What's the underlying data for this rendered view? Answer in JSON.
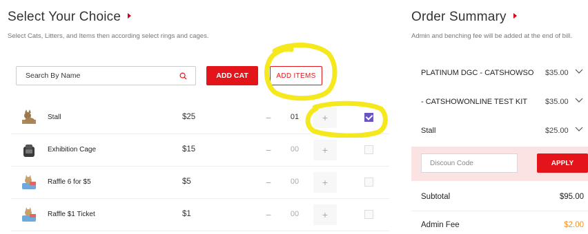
{
  "left_panel": {
    "title": "Select Your Choice",
    "subtitle": "Select Cats, Litters, and Items then according select rings and cages.",
    "search": {
      "placeholder": "Search By Name"
    },
    "add_cat_label": "ADD CAT",
    "add_items_label": "ADD ITEMS",
    "items": [
      {
        "name": "Stall",
        "price": "$25",
        "minus": "−",
        "qty": "01",
        "plus": "+",
        "checked": true,
        "icon": "cat-stall-icon"
      },
      {
        "name": "Exhibition Cage",
        "price": "$15",
        "minus": "−",
        "qty": "00",
        "plus": "+",
        "checked": false,
        "icon": "cage-icon"
      },
      {
        "name": "Raffle 6 for $5",
        "price": "$5",
        "minus": "−",
        "qty": "00",
        "plus": "+",
        "checked": false,
        "icon": "raffle-ticket-icon"
      },
      {
        "name": "Raffle $1 Ticket",
        "price": "$1",
        "minus": "−",
        "qty": "00",
        "plus": "+",
        "checked": false,
        "icon": "raffle-ticket-icon"
      }
    ]
  },
  "right_panel": {
    "title": "Order Summary",
    "subtitle": "Admin and benching fee will be added at the end of bill.",
    "lines": [
      {
        "label": "PLATINUM DGC - CATSHOWSO",
        "amount": "$35.00"
      },
      {
        "label": "- CATSHOWONLINE TEST KIT",
        "amount": "$35.00"
      },
      {
        "label": "Stall",
        "amount": "$25.00"
      }
    ],
    "discount": {
      "placeholder": "Discoun Code",
      "apply_label": "APPLY"
    },
    "subtotal_label": "Subtotal",
    "subtotal_value": "$95.00",
    "admin_fee_label": "Admin Fee",
    "admin_fee_value": "$2.00"
  },
  "colors": {
    "accent_red": "#e3151b",
    "checkbox_purple": "#6a54c4",
    "discount_bg": "#fbe3e3",
    "admin_fee_orange": "#f0932b",
    "highlight_yellow": "#f5e81c"
  }
}
